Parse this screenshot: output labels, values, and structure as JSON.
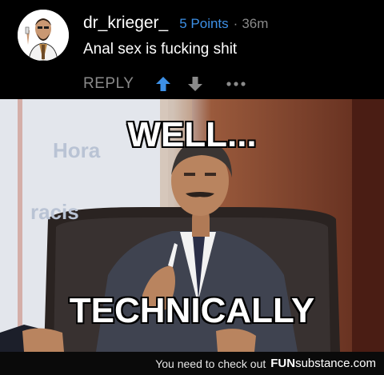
{
  "comment": {
    "username": "dr_krieger_",
    "points": "5 Points",
    "separator": "·",
    "time": "36m",
    "text": "Anal sex is fucking shit",
    "reply_label": "REPLY",
    "upvote_icon": "arrow-up-icon",
    "downvote_icon": "arrow-down-icon",
    "more_icon": "ellipsis-icon",
    "accent_color": "#3d90e6"
  },
  "meme": {
    "top_caption": "WELL...",
    "bottom_caption": "TECHNICALLY",
    "background_text_1": "Hora",
    "background_text_2": "racis"
  },
  "footer": {
    "text": "You need to check out",
    "brand_bold": "FUN",
    "brand_rest": "substance",
    "brand_suffix": ".com"
  }
}
